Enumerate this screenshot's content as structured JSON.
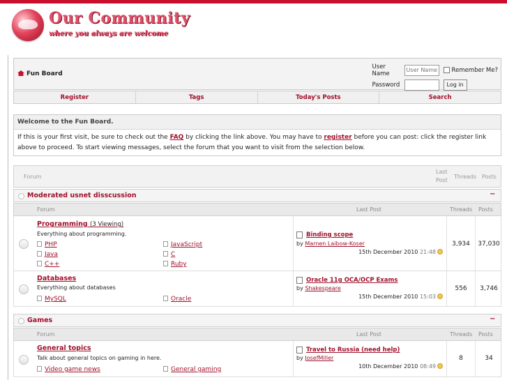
{
  "header": {
    "logo_title": "Our Community",
    "logo_tagline": "where you always are welcome"
  },
  "navbar": {
    "breadcrumb": "Fun Board",
    "login": {
      "username_label": "User Name",
      "username_placeholder": "User Name",
      "remember_label": "Remember Me?",
      "password_label": "Password",
      "login_button": "Log in"
    },
    "menu": [
      "Register",
      "Tags",
      "Today's Posts",
      "Search"
    ]
  },
  "welcome": {
    "title": "Welcome to the Fun Board.",
    "text1": "If this is your first visit, be sure to check out the ",
    "faq": "FAQ",
    "text2": " by clicking the link above. You may have to ",
    "register": "register",
    "text3": " before you can post: click the register link above to proceed. To start viewing messages, select the forum that you want to visit from the selection below."
  },
  "forum_header": {
    "forum": "Forum",
    "last_post_1": "Last",
    "last_post_2": "Post",
    "threads": "Threads",
    "posts": "Posts"
  },
  "column_headers": {
    "forum": "Forum",
    "last_post": "Last Post",
    "threads": "Threads",
    "posts": "Posts"
  },
  "sections": [
    {
      "title": "Moderated usnet disscussion",
      "collapse": "−",
      "forums": [
        {
          "name": "Programming",
          "viewing": "(3 Viewing)",
          "description": "Everything about programming.",
          "subforums": [
            "PHP",
            "JavaScript",
            "Java",
            "C",
            "C++",
            "Ruby"
          ],
          "last_post": {
            "title": "Binding scope",
            "by": "by ",
            "author": "Marnen Laibow-Koser",
            "date": "15th December 2010",
            "time": "21:48"
          },
          "threads": "3,934",
          "posts": "37,030"
        },
        {
          "name": "Databases",
          "viewing": "",
          "description": "Everything about databases",
          "subforums": [
            "MySQL",
            "Oracle"
          ],
          "last_post": {
            "title": "Oracle 11g OCA/OCP Exams",
            "by": "by ",
            "author": "Shakespeare",
            "date": "15th December 2010",
            "time": "15:03"
          },
          "threads": "556",
          "posts": "3,746"
        }
      ]
    },
    {
      "title": "Games",
      "collapse": "−",
      "forums": [
        {
          "name": "General topics",
          "viewing": "",
          "description": "Talk about general topics on gaming in here.",
          "subforums": [
            "Video game news",
            "General gaming"
          ],
          "last_post": {
            "title": "Travel to Russia (need help)",
            "by": "by ",
            "author": "JosefMiller",
            "date": "10th December 2010",
            "time": "08:49"
          },
          "threads": "8",
          "posts": "34"
        }
      ]
    }
  ],
  "colors": {
    "accent": "#a0102a",
    "topbar": "#c8102e"
  }
}
